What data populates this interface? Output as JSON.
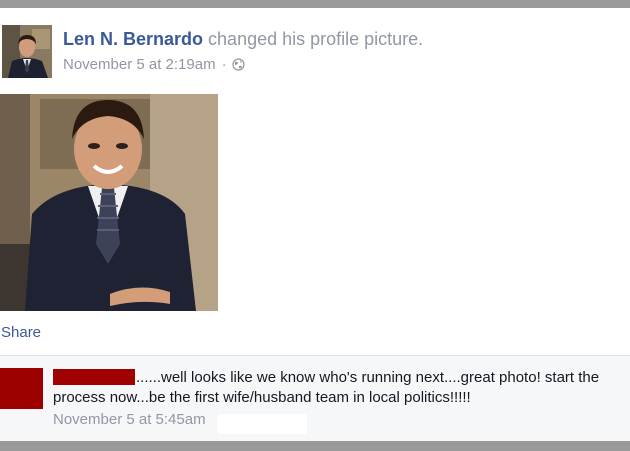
{
  "post": {
    "author_name": "Len N. Bernardo",
    "action_text": "changed his profile picture.",
    "timestamp": "November 5 at 2:19am",
    "separator": "·",
    "privacy_icon": "globe-icon",
    "share_label": "Share"
  },
  "comment": {
    "text": "......well looks like we know who's running next....great photo! start the process now...be the first wife/husband team in local politics!!!!!",
    "timestamp": "November 5 at 5:45am"
  },
  "colors": {
    "link_blue": "#3b5998",
    "meta_gray": "#9197a3",
    "redaction_red": "#a10000",
    "frame_gray": "#9a9a9a"
  }
}
